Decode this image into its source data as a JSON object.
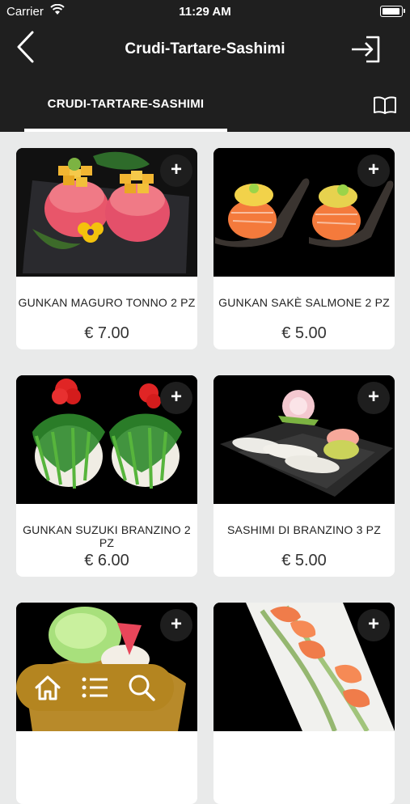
{
  "status_bar": {
    "carrier": "Carrier",
    "time": "11:29 AM"
  },
  "nav": {
    "title": "Crudi-Tartare-Sashimi",
    "back_icon": "chevron-left-icon",
    "login_icon": "login-arrow-icon"
  },
  "tabs": [
    {
      "label": "CRUDI-TARTARE-SASHIMI",
      "active": true
    }
  ],
  "menu_icon": "book-icon",
  "products": [
    {
      "name": "GUNKAN MAGURO TONNO 2 PZ",
      "price": "€ 7.00"
    },
    {
      "name": "GUNKAN SAKÈ SALMONE 2 PZ",
      "price": "€ 5.00"
    },
    {
      "name": "GUNKAN SUZUKI BRANZINO 2 PZ",
      "price": "€ 6.00"
    },
    {
      "name": "SASHIMI DI BRANZINO  3 PZ",
      "price": "€ 5.00"
    },
    {
      "name": "",
      "price": ""
    },
    {
      "name": "",
      "price": ""
    }
  ],
  "add_label": "+",
  "bottom_bar": {
    "icons": [
      "home-icon",
      "list-icon",
      "search-icon"
    ],
    "color": "#b48520"
  },
  "colors": {
    "header_bg": "#1f1f1f",
    "page_bg": "#e9eaea",
    "accent": "#b48520"
  }
}
